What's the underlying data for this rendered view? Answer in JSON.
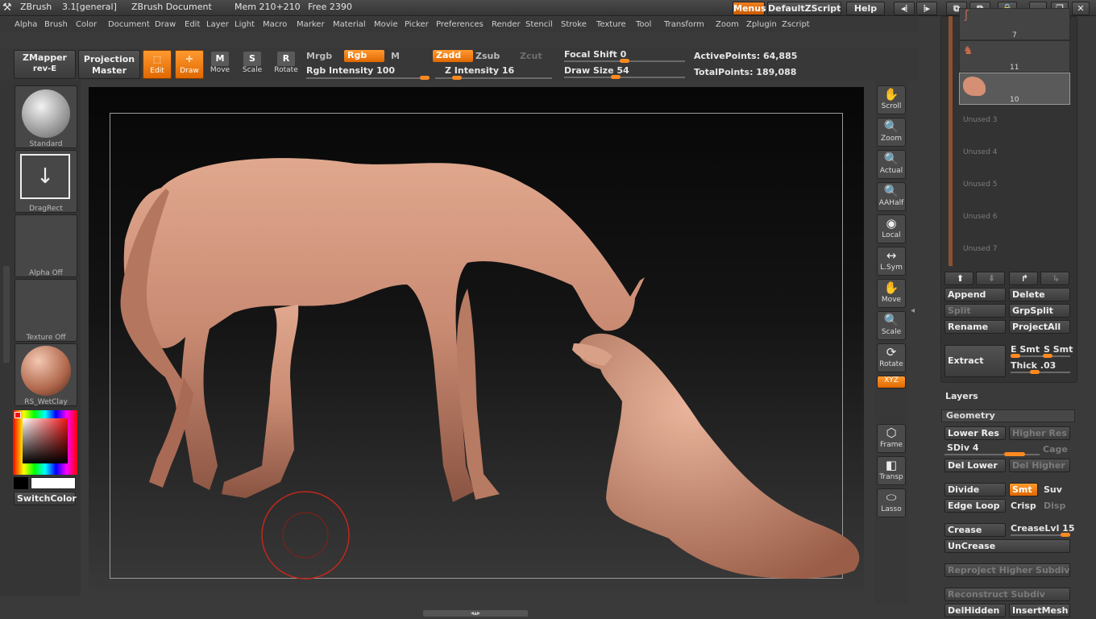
{
  "titlebar": {
    "app": "ZBrush",
    "version": "3.1[general]",
    "document": "ZBrush Document",
    "mem": "Mem 210+210",
    "free": "Free 2390",
    "menus_btn": "Menus",
    "script_btn": "DefaultZScript",
    "help_btn": "Help"
  },
  "menu": [
    "Alpha",
    "Brush",
    "Color",
    "Document",
    "Draw",
    "Edit",
    "Layer",
    "Light",
    "Macro",
    "Marker",
    "Material",
    "Movie",
    "Picker",
    "Preferences",
    "Render",
    "Stencil",
    "Stroke",
    "Texture",
    "Tool",
    "Transform",
    "Zoom",
    "Zplugin",
    "Zscript"
  ],
  "toolbar": {
    "zmapper": "ZMapper",
    "zmapper_rev": "rev-E",
    "projection": "Projection",
    "projection_sub": "Master",
    "edit": "Edit",
    "draw": "Draw",
    "move": "Move",
    "scale": "Scale",
    "rotate": "Rotate",
    "mrgb": "Mrgb",
    "rgb": "Rgb",
    "m": "M",
    "rgb_intensity": "Rgb Intensity 100",
    "rgb_intensity_value": 100,
    "zadd": "Zadd",
    "zsub": "Zsub",
    "zcut": "Zcut",
    "z_intensity": "Z Intensity 16",
    "z_intensity_value": 16,
    "focal_shift": "Focal Shift 0",
    "focal_value": 0,
    "draw_size": "Draw Size 54",
    "draw_size_value": 54,
    "active_points": "ActivePoints: 64,885",
    "total_points": "TotalPoints: 189,088"
  },
  "leftshelf": {
    "brush": "Standard",
    "stroke": "DragRect",
    "alpha": "Alpha Off",
    "texture": "Texture Off",
    "material": "RS_WetClay",
    "switch_color": "SwitchColor"
  },
  "rightshelf": [
    "Scroll",
    "Zoom",
    "Actual",
    "AAHalf",
    "Local",
    "L.Sym",
    "Move",
    "Scale",
    "Rotate",
    "XYZ",
    "Frame",
    "Transp",
    "Lasso"
  ],
  "subtools": {
    "counts": [
      "7",
      "11",
      "10"
    ],
    "unused": [
      "Unused 3",
      "Unused 4",
      "Unused 5",
      "Unused 6",
      "Unused 7"
    ],
    "append": "Append",
    "delete": "Delete",
    "split": "Split",
    "grpsplit": "GrpSplit",
    "rename": "Rename",
    "projectall": "ProjectAll",
    "extract": "Extract",
    "esmt": "E Smt",
    "ssmt": "S Smt",
    "thick": "Thick .03"
  },
  "layers": "Layers",
  "geometry": {
    "title": "Geometry",
    "lower_res": "Lower Res",
    "higher_res": "Higher Res",
    "sdiv": "SDiv 4",
    "sdiv_value": 4,
    "cage": "Cage",
    "del_lower": "Del Lower",
    "del_higher": "Del Higher",
    "divide": "Divide",
    "smt": "Smt",
    "suv": "Suv",
    "edge_loop": "Edge Loop",
    "crisp": "Crisp",
    "disp": "Disp",
    "crease": "Crease",
    "creaselvl": "CreaseLvl 15",
    "uncrease": "UnCrease",
    "reproject": "Reproject Higher Subdiv",
    "reconstruct": "Reconstruct Subdiv",
    "delhidden": "DelHidden",
    "insertmesh": "InsertMesh"
  },
  "colors": {
    "accent": "#f07a18",
    "clay": "#c98a72"
  }
}
